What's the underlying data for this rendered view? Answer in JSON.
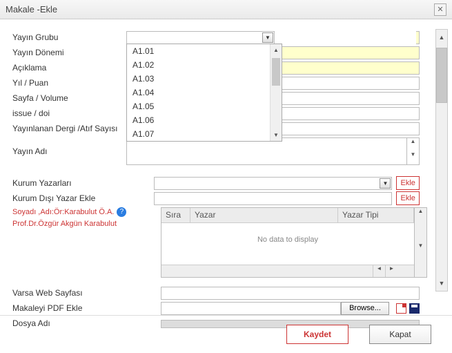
{
  "window": {
    "title": "Makale -Ekle"
  },
  "labels": {
    "yayin_grubu": "Yayın Grubu",
    "yayin_donemi": "Yayın Dönemi",
    "aciklama": "Açıklama",
    "yil_puan": "Yıl / Puan",
    "sayfa_volume": "Sayfa / Volume",
    "issue_doi": "issue / doi",
    "dergi_atif": "Yayınlanan Dergi /Atıf Sayısı",
    "yayin_adi": "Yayın Adı",
    "kurum_yazarlari": "Kurum Yazarları",
    "kurum_disi": "Kurum Dışı Yazar Ekle",
    "hint1": "Soyadı ,Adı:Ör:Karabulut Ö.A.",
    "hint2": "Prof.Dr.Özgür Akgün Karabulut",
    "varsa_web": "Varsa Web Sayfası",
    "pdf_ekle": "Makaleyi PDF Ekle",
    "dosya_adi": "Dosya Adı"
  },
  "dropdown_options": [
    "A1.01",
    "A1.02",
    "A1.03",
    "A1.04",
    "A1.05",
    "A1.06",
    "A1.07"
  ],
  "grid": {
    "col_sira": "Sıra",
    "col_yazar": "Yazar",
    "col_tip": "Yazar Tipi",
    "empty": "No data to display"
  },
  "buttons": {
    "ekle": "Ekle",
    "browse": "Browse...",
    "kaydet": "Kaydet",
    "kapat": "Kapat"
  }
}
